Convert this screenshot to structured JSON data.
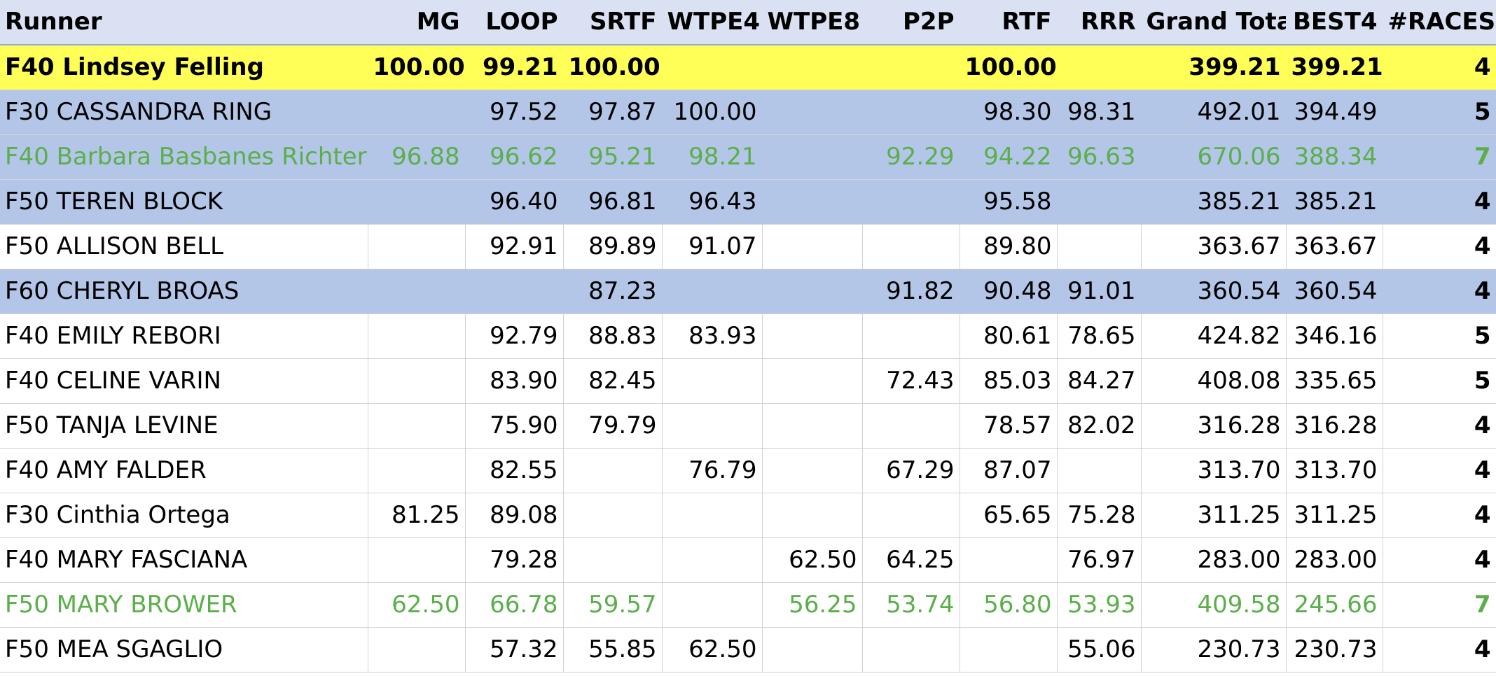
{
  "columns": [
    "Runner",
    "MG",
    "LOOP",
    "SRTF",
    "WTPE4",
    "WTPE8",
    "P2P",
    "RTF",
    "RRR",
    "Grand Total",
    "BEST4",
    "#RACES"
  ],
  "colors": {
    "header_bg": "#d9e1f2",
    "highlight_yellow": "#ffff57",
    "highlight_blue": "#b4c6e7",
    "green_text": "#5aaf4b"
  },
  "rows": [
    {
      "style": "yellow",
      "cells": [
        "F40 Lindsey Felling",
        "100.00",
        "99.21",
        "100.00",
        "",
        "",
        "",
        "100.00",
        "",
        "399.21",
        "399.21",
        "4"
      ]
    },
    {
      "style": "blue",
      "cells": [
        "F30 CASSANDRA RING",
        "",
        "97.52",
        "97.87",
        "100.00",
        "",
        "",
        "98.30",
        "98.31",
        "492.01",
        "394.49",
        "5"
      ]
    },
    {
      "style": "blue green",
      "cells": [
        "F40 Barbara Basbanes Richter",
        "96.88",
        "96.62",
        "95.21",
        "98.21",
        "",
        "92.29",
        "94.22",
        "96.63",
        "670.06",
        "388.34",
        "7"
      ]
    },
    {
      "style": "blue",
      "cells": [
        "F50 TEREN BLOCK",
        "",
        "96.40",
        "96.81",
        "96.43",
        "",
        "",
        "95.58",
        "",
        "385.21",
        "385.21",
        "4"
      ]
    },
    {
      "style": "plain",
      "cells": [
        "F50 ALLISON BELL",
        "",
        "92.91",
        "89.89",
        "91.07",
        "",
        "",
        "89.80",
        "",
        "363.67",
        "363.67",
        "4"
      ]
    },
    {
      "style": "blue",
      "cells": [
        "F60 CHERYL BROAS",
        "",
        "",
        "87.23",
        "",
        "",
        "91.82",
        "90.48",
        "91.01",
        "360.54",
        "360.54",
        "4"
      ]
    },
    {
      "style": "plain",
      "cells": [
        "F40 EMILY REBORI",
        "",
        "92.79",
        "88.83",
        "83.93",
        "",
        "",
        "80.61",
        "78.65",
        "424.82",
        "346.16",
        "5"
      ]
    },
    {
      "style": "plain",
      "cells": [
        "F40 CELINE VARIN",
        "",
        "83.90",
        "82.45",
        "",
        "",
        "72.43",
        "85.03",
        "84.27",
        "408.08",
        "335.65",
        "5"
      ]
    },
    {
      "style": "plain",
      "cells": [
        "F50 TANJA LEVINE",
        "",
        "75.90",
        "79.79",
        "",
        "",
        "",
        "78.57",
        "82.02",
        "316.28",
        "316.28",
        "4"
      ]
    },
    {
      "style": "plain",
      "cells": [
        "F40 AMY FALDER",
        "",
        "82.55",
        "",
        "76.79",
        "",
        "67.29",
        "87.07",
        "",
        "313.70",
        "313.70",
        "4"
      ]
    },
    {
      "style": "plain",
      "cells": [
        "F30 Cinthia Ortega",
        "81.25",
        "89.08",
        "",
        "",
        "",
        "",
        "65.65",
        "75.28",
        "311.25",
        "311.25",
        "4"
      ]
    },
    {
      "style": "plain",
      "cells": [
        "F40 MARY FASCIANA",
        "",
        "79.28",
        "",
        "",
        "62.50",
        "64.25",
        "",
        "76.97",
        "283.00",
        "283.00",
        "4"
      ]
    },
    {
      "style": "green",
      "cells": [
        "F50 MARY BROWER",
        "62.50",
        "66.78",
        "59.57",
        "",
        "56.25",
        "53.74",
        "56.80",
        "53.93",
        "409.58",
        "245.66",
        "7"
      ]
    },
    {
      "style": "plain",
      "cells": [
        "F50 MEA SGAGLIO",
        "",
        "57.32",
        "55.85",
        "62.50",
        "",
        "",
        "",
        "55.06",
        "230.73",
        "230.73",
        "4"
      ]
    }
  ]
}
